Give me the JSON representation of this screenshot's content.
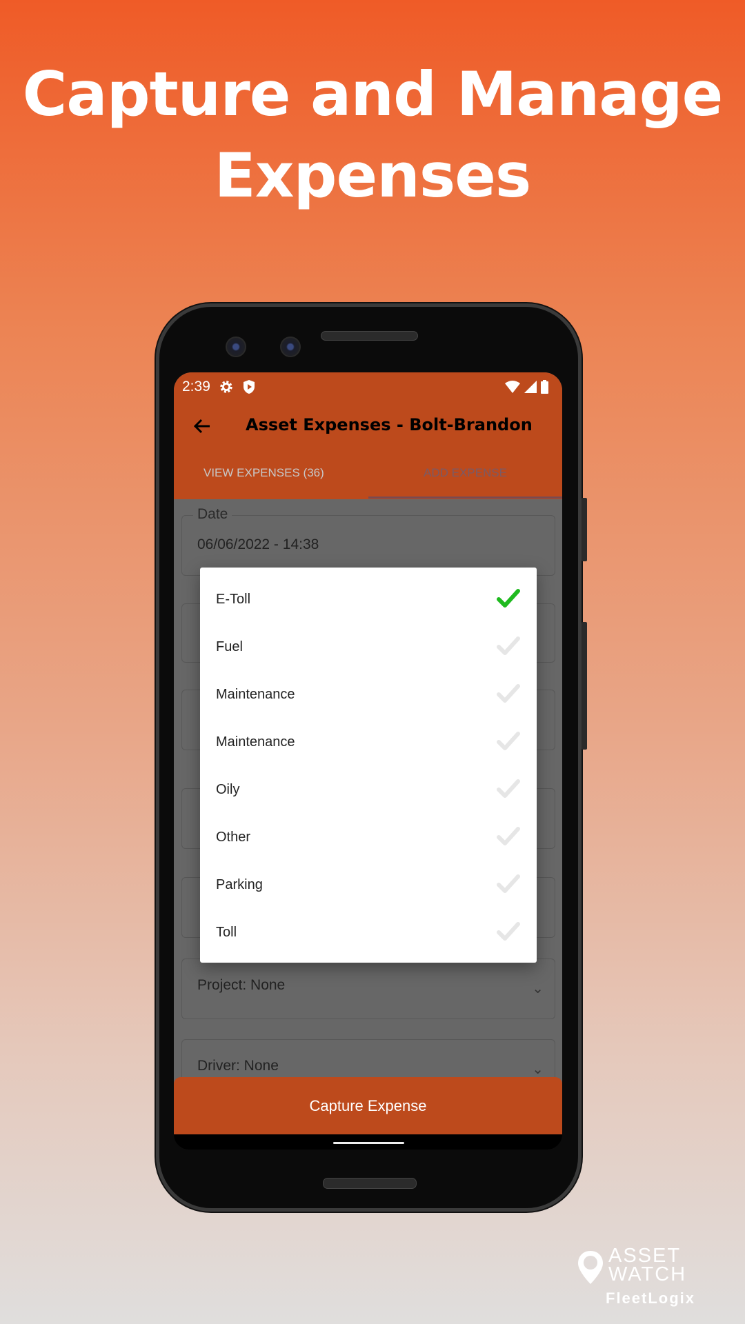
{
  "headline": {
    "line1": "Capture and Manage",
    "line2": "Expenses"
  },
  "status_bar": {
    "time": "2:39",
    "icons": [
      "gear-icon",
      "shield-play-icon",
      "wifi-icon",
      "signal-icon",
      "battery-icon"
    ]
  },
  "app_bar": {
    "title": "Asset Expenses - Bolt-Brandon",
    "back_icon": "arrow-left-icon"
  },
  "tabs": [
    {
      "label": "VIEW EXPENSES (36)",
      "active": false
    },
    {
      "label": "ADD EXPENSE",
      "active": true
    }
  ],
  "form": {
    "date": {
      "label": "Date",
      "value": "06/06/2022 - 14:38"
    },
    "project": {
      "value": "Project: None"
    },
    "driver": {
      "value": "Driver: None"
    }
  },
  "dialog": {
    "items": [
      {
        "label": "E-Toll",
        "selected": true
      },
      {
        "label": "Fuel",
        "selected": false
      },
      {
        "label": "Maintenance",
        "selected": false
      },
      {
        "label": "Maintenance",
        "selected": false
      },
      {
        "label": "Oily",
        "selected": false
      },
      {
        "label": "Other",
        "selected": false
      },
      {
        "label": "Parking",
        "selected": false
      },
      {
        "label": "Toll",
        "selected": false
      }
    ]
  },
  "capture_button": {
    "label": "Capture Expense"
  },
  "logo": {
    "line1": "ASSET",
    "line2": "WATCH",
    "brand": "FleetLogix"
  },
  "colors": {
    "accent": "#bd4a1c",
    "selected_check": "#1fba1f",
    "unselected_check": "#e6e6e6"
  }
}
